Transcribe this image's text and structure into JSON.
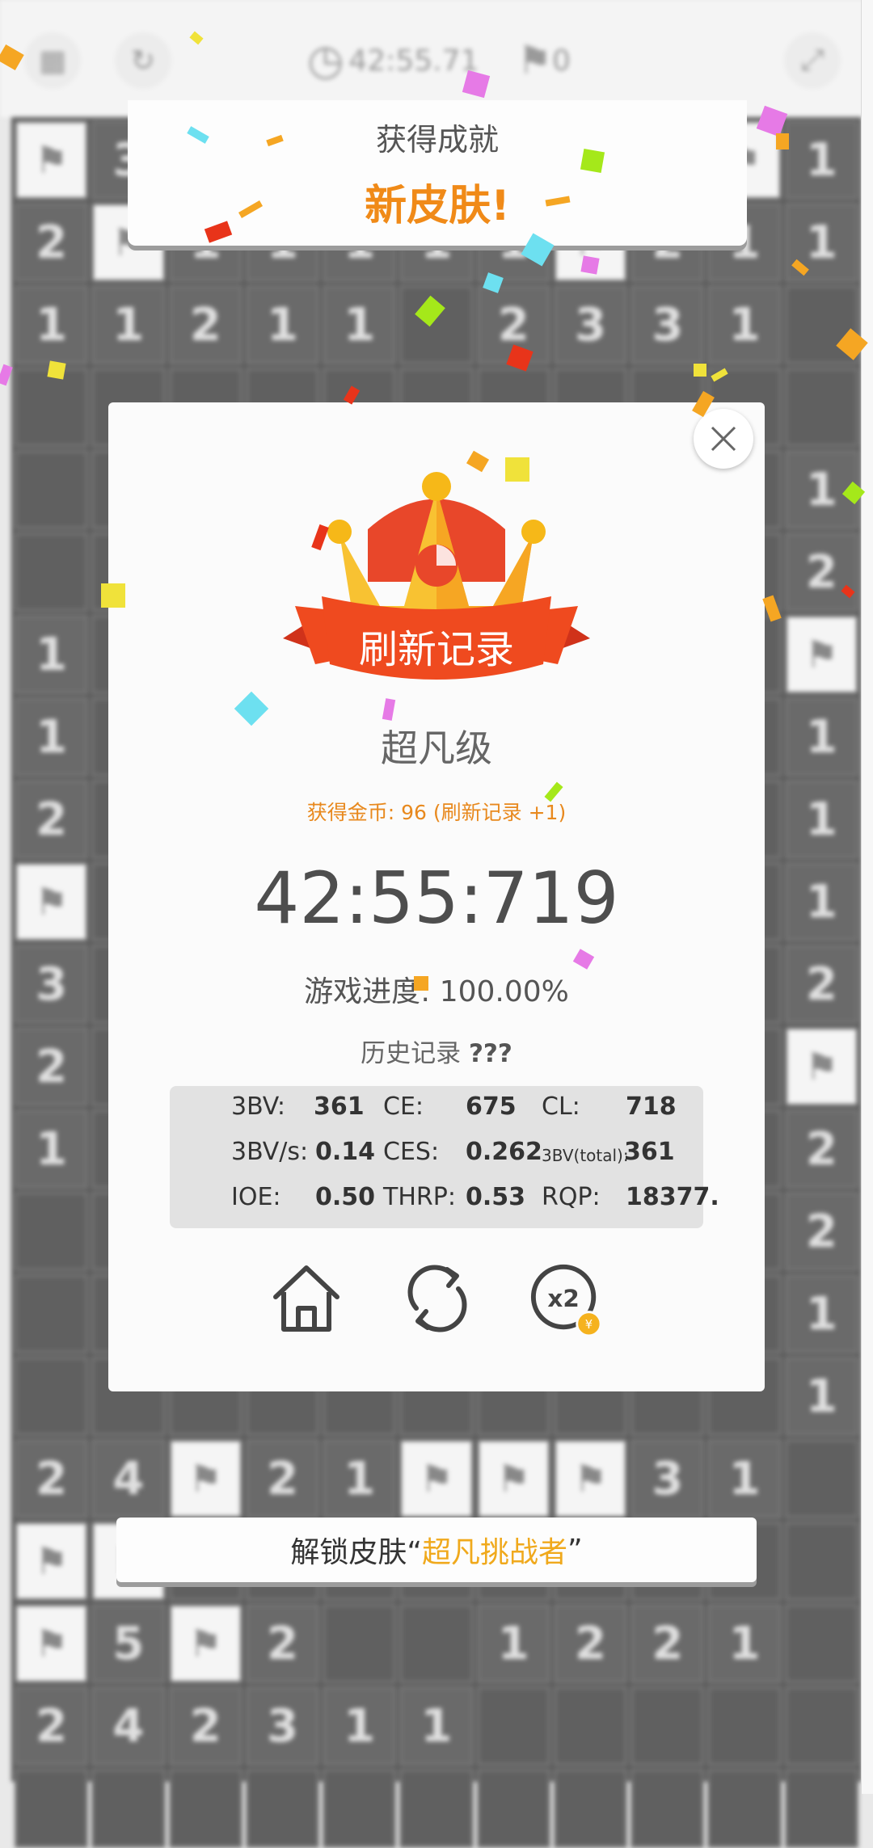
{
  "topbar": {
    "timer": "42:55.71",
    "flags": "0"
  },
  "board": {
    "rows": [
      [
        "F",
        "3",
        "",
        "",
        "",
        "",
        "",
        "",
        "",
        "F",
        "1"
      ],
      [
        "2",
        "F",
        "1",
        "1",
        "1",
        "1",
        "1",
        "F",
        "2",
        "1",
        "1"
      ],
      [
        "1",
        "1",
        "2",
        "1",
        "1",
        "",
        "2",
        "3",
        "3",
        "1",
        ""
      ],
      [
        "",
        "",
        "",
        "",
        "",
        "",
        "",
        "",
        "",
        "",
        ""
      ],
      [
        "",
        "",
        "",
        "",
        "",
        "",
        "",
        "",
        "",
        "",
        "1"
      ],
      [
        "",
        "",
        "",
        "",
        "",
        "",
        "",
        "",
        "",
        "",
        "2"
      ],
      [
        "1",
        "",
        "",
        "",
        "",
        "",
        "",
        "",
        "",
        "",
        "F"
      ],
      [
        "1",
        "",
        "",
        "",
        "",
        "",
        "",
        "",
        "",
        "",
        "1"
      ],
      [
        "2",
        "",
        "",
        "",
        "",
        "",
        "",
        "",
        "",
        "",
        "1"
      ],
      [
        "F",
        "",
        "",
        "",
        "",
        "",
        "",
        "",
        "",
        "",
        "1"
      ],
      [
        "3",
        "",
        "",
        "",
        "",
        "",
        "",
        "",
        "",
        "",
        "2"
      ],
      [
        "2",
        "",
        "",
        "",
        "",
        "",
        "",
        "",
        "",
        "",
        "F"
      ],
      [
        "1",
        "",
        "",
        "",
        "",
        "",
        "",
        "",
        "",
        "",
        "2"
      ],
      [
        "",
        "",
        "",
        "",
        "",
        "",
        "",
        "",
        "",
        "",
        "2"
      ],
      [
        "",
        "",
        "",
        "",
        "",
        "",
        "",
        "",
        "",
        "",
        "1"
      ],
      [
        "",
        "",
        "",
        "",
        "",
        "",
        "",
        "",
        "",
        "",
        "1"
      ],
      [
        "2",
        "4",
        "F",
        "2",
        "1",
        "F",
        "F",
        "F",
        "3",
        "1",
        ""
      ],
      [
        "F",
        "F",
        "",
        "",
        "",
        "",
        "",
        "",
        "",
        "",
        ""
      ],
      [
        "F",
        "5",
        "F",
        "2",
        "",
        "",
        "1",
        "2",
        "2",
        "1",
        ""
      ],
      [
        "2",
        "4",
        "2",
        "3",
        "1",
        "1",
        "",
        "",
        "",
        "",
        ""
      ],
      [
        "",
        "",
        "",
        "",
        "",
        "",
        "",
        "",
        "",
        "",
        ""
      ]
    ]
  },
  "achievement": {
    "title": "获得成就",
    "subtitle": "新皮肤!"
  },
  "result": {
    "banner": "刷新记录",
    "rank": "超凡级",
    "coins": "获得金币: 96 (刷新记录 +1)",
    "time": "42:55:719",
    "progress_label": "游戏进度:",
    "progress_value": "100.00%",
    "history_label": "历史记录",
    "history_value": "???",
    "stats": {
      "bbbv_label": "3BV:",
      "bbbv_value": "361",
      "ce_label": "CE:",
      "ce_value": "675",
      "cl_label": "CL:",
      "cl_value": "718",
      "bbbvs_label": "3BV/s:",
      "bbbvs_value": "0.14",
      "ces_label": "CES:",
      "ces_value": "0.262",
      "bbbvt_label": "3BV(total):",
      "bbbvt_value": "361",
      "ioe_label": "IOE:",
      "ioe_value": "0.50",
      "thrp_label": "THRP:",
      "thrp_value": "0.53",
      "rqp_label": "RQP:",
      "rqp_value": "18377."
    },
    "buttons": {
      "double_badge": "x2",
      "coin_symbol": "¥"
    }
  },
  "unlock": {
    "prefix": "解锁皮肤“",
    "skin": "超凡挑战者",
    "suffix": "”"
  },
  "icons": [
    "calendar-icon",
    "refresh-icon",
    "clock-icon",
    "flag-icon",
    "expand-icon",
    "close-icon",
    "crown-icon",
    "home-icon",
    "restart-icon",
    "double-reward-icon",
    "coin-icon"
  ],
  "colors": {
    "accent_orange": "#f08a18",
    "highlight_yellow": "#f0a91c",
    "ribbon_red": "#e8401c",
    "crown_gold": "#f8c02c"
  }
}
